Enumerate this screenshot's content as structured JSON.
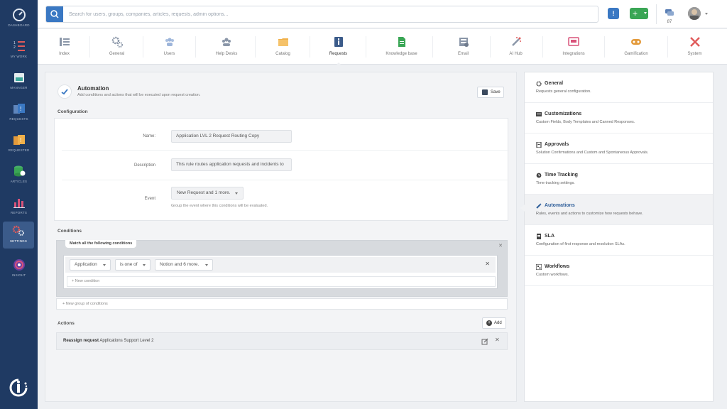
{
  "nav": {
    "items": [
      {
        "label": "DASHBOARD",
        "icon": "gauge-icon"
      },
      {
        "label": "MY WORK",
        "icon": "list-numbered-icon"
      },
      {
        "label": "MANAGER",
        "icon": "manager-icon"
      },
      {
        "label": "REQUESTS",
        "icon": "requests-icon"
      },
      {
        "label": "REQUESTED",
        "icon": "requested-icon"
      },
      {
        "label": "ARTICLES",
        "icon": "articles-icon"
      },
      {
        "label": "REPORTS",
        "icon": "bar-chart-icon"
      },
      {
        "label": "SETTINGS",
        "icon": "settings-icon"
      },
      {
        "label": "INSIGHT",
        "icon": "insight-icon"
      }
    ],
    "active_index": 7
  },
  "topbar": {
    "search_placeholder": "Search for users, groups, companies, articles, requests, admin options...",
    "info_label": "!",
    "add_label": "+",
    "chat_count": "87"
  },
  "tabs": [
    {
      "label": "Index",
      "icon": "index-icon"
    },
    {
      "label": "General",
      "icon": "gears-icon"
    },
    {
      "label": "Users",
      "icon": "users-icon"
    },
    {
      "label": "Help Desks",
      "icon": "help-desks-icon"
    },
    {
      "label": "Catalog",
      "icon": "folder-icon"
    },
    {
      "label": "Requests",
      "icon": "request-info-icon"
    },
    {
      "label": "Knowledge base",
      "icon": "document-icon"
    },
    {
      "label": "Email",
      "icon": "email-icon"
    },
    {
      "label": "AI Hub",
      "icon": "magic-wand-icon"
    },
    {
      "label": "Integrations",
      "icon": "integrations-icon"
    },
    {
      "label": "Gamification",
      "icon": "gamepad-icon"
    },
    {
      "label": "System",
      "icon": "tools-icon"
    }
  ],
  "active_tab_index": 5,
  "header": {
    "title": "Automation",
    "subtitle": "Add conditions and actions that will be executed upon request creation.",
    "save_label": "Save"
  },
  "configuration": {
    "section_title": "Configuration",
    "name_label": "Name:",
    "name_value": "Application LVL 2 Request Routing Copy",
    "description_label": "Description",
    "description_value": "This rule routes application requests and incidents to",
    "event_label": "Event",
    "event_value": "New Request and 1 more.",
    "event_help": "Group the event where this conditions will be evaluated."
  },
  "conditions": {
    "section_title": "Conditions",
    "match_label": "Match all the following conditions",
    "field_value": "Application",
    "operator_value": "is one of",
    "values_value": "Notion and 6 more.",
    "new_condition_label": "+ New condition",
    "new_group_label": "+ New group of conditions"
  },
  "actions": {
    "section_title": "Actions",
    "add_label": "Add",
    "row_bold": "Reassign request",
    "row_text": "Applications Support Level 2"
  },
  "side": {
    "items": [
      {
        "title": "General",
        "desc": "Requests general configuration.",
        "icon": "gear-icon"
      },
      {
        "title": "Customizations",
        "desc": "Custom Fields, Body Templates and Canned Responses.",
        "icon": "customizations-icon"
      },
      {
        "title": "Approvals",
        "desc": "Solution Confirmations and Custom and Spontaneous Approvals.",
        "icon": "approvals-icon"
      },
      {
        "title": "Time Tracking",
        "desc": "Time tracking settings.",
        "icon": "clock-icon"
      },
      {
        "title": "Automations",
        "desc": "Rules, events and actions to customize how requests behave.",
        "icon": "pencil-icon"
      },
      {
        "title": "SLA",
        "desc": "Configuration of first response and resolution SLAs.",
        "icon": "sla-icon"
      },
      {
        "title": "Workflows",
        "desc": "Custom workflows.",
        "icon": "workflow-icon"
      }
    ],
    "active_index": 4
  },
  "colors": {
    "nav_bg": "#1f3a63",
    "accent_blue": "#3a78c3",
    "accent_green": "#3aa655"
  }
}
